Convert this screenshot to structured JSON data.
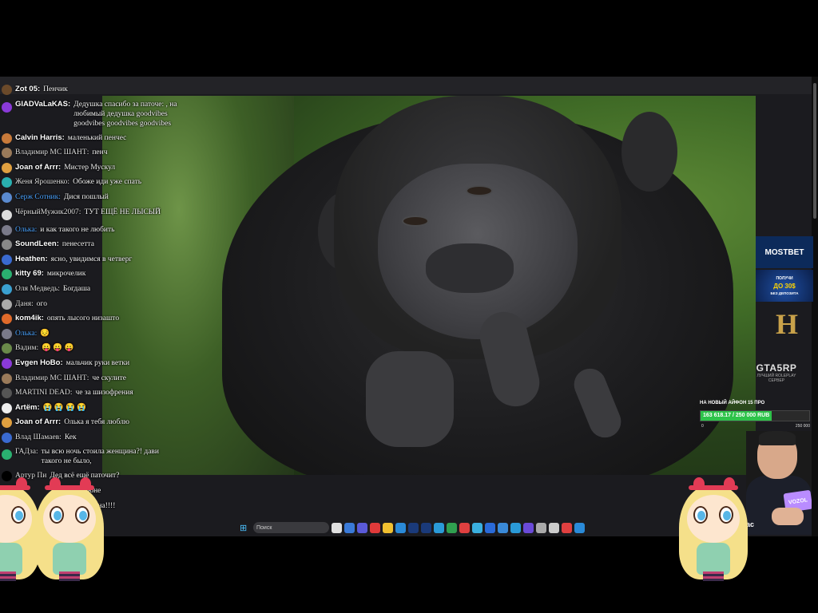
{
  "chat": {
    "messages": [
      {
        "user": "Zot 05:",
        "text": "Пенчик",
        "style": "bold",
        "avatar": "#6b4a2a"
      },
      {
        "user": "GlADVaLaKAS:",
        "text": "Дедушка спасибо за паточе: , на любимый дедушка  goodvibes  goodvibes  goodvibes  goodvibes",
        "style": "bold",
        "avatar": "#8a3ad8",
        "multi": true
      },
      {
        "user": "Calvin Harris:",
        "text": "маленький пенчес",
        "style": "bold",
        "avatar": "#c87a3a"
      },
      {
        "user": "Владимир MC ШАНТ:",
        "text": "пенч",
        "style": "plain",
        "avatar": "#9a7a5a"
      },
      {
        "user": "Joan of Arrr:",
        "text": "Мистер Мускул",
        "style": "bold",
        "avatar": "#e0a040"
      },
      {
        "user": "Женя Ярошенко:",
        "text": "Обоже иди уже спать",
        "style": "plain",
        "avatar": "#2ab0b0"
      },
      {
        "user": "Серж Сотник:",
        "text": "Дися пошлый",
        "style": "blue",
        "avatar": "#5a8ad0"
      },
      {
        "user": "ЧёрныйМужик2007:",
        "text": "ТУТ ЕЩЁ НЕ ЛЫСЫЙ",
        "style": "plain",
        "avatar": "#ddd",
        "multi": true
      },
      {
        "user": "Олька:",
        "text": "и как такого не любить",
        "style": "blue",
        "avatar": "#7a7a8a"
      },
      {
        "user": "SoundLeen:",
        "text": "пенесетта",
        "style": "bold",
        "avatar": "#888"
      },
      {
        "user": "Heathen:",
        "text": "ясно, увидимся в четверг",
        "style": "bold",
        "avatar": "#3a6ad0"
      },
      {
        "user": "kitty 69:",
        "text": "микрочелик",
        "style": "bold",
        "avatar": "#2ab070"
      },
      {
        "user": "Оля Медведь:",
        "text": "Богдаша",
        "style": "plain",
        "avatar": "#3aa0d0"
      },
      {
        "user": "Даня:",
        "text": "ого",
        "style": "plain",
        "avatar": "#aaa"
      },
      {
        "user": "kom4ik:",
        "text": "опять лысого низашто",
        "style": "bold",
        "avatar": "#e06a2a"
      },
      {
        "user": "Олька:",
        "text": "😔",
        "style": "blue",
        "avatar": "#7a7a8a"
      },
      {
        "user": "Вадим:",
        "text": "😛 😛 😛",
        "style": "plain",
        "avatar": "#6a8a4a"
      },
      {
        "user": "Evgen HoBo:",
        "text": "мальчик руки ветки",
        "style": "bold",
        "avatar": "#8a3ad8"
      },
      {
        "user": "Владимир MC ШАНТ:",
        "text": "че скулите",
        "style": "plain",
        "avatar": "#9a7a5a"
      },
      {
        "user": "MARTINI DEAD:",
        "text": "че за шизофрения",
        "style": "plain",
        "avatar": "#555"
      },
      {
        "user": "Artëm:",
        "text": "😭 😭 😭 😭",
        "style": "bold",
        "avatar": "#eee"
      },
      {
        "user": "Joan of Arrr:",
        "text": "Олька я тебя люблю",
        "style": "bold",
        "avatar": "#e0a040"
      },
      {
        "user": "Влад Шамаев:",
        "text": "Кек",
        "style": "plain",
        "avatar": "#3a6ad0"
      },
      {
        "user": "ГАДза:",
        "text": "ты всю ночь стоила женщина?! дави такого не было,",
        "style": "plain",
        "avatar": "#2ab070",
        "multi": true
      },
      {
        "user": "Артур Пи",
        "text": "Дед всё ещё паточит?",
        "style": "plain",
        "avatar": "#000"
      }
    ],
    "partial_lines": [
      "юне",
      "щина!!!!"
    ],
    "emote_name": "goodvibes"
  },
  "taskbar": {
    "start_glyph": "⊞",
    "search_placeholder": "Поиск",
    "icon_colors": [
      "#e0e0e0",
      "#3a7ad8",
      "#5a5ad8",
      "#e03a3a",
      "#f0c030",
      "#2a8ad8",
      "#1a3a7a",
      "#1a3a7a",
      "#2a9ad8",
      "#30a050",
      "#e04040",
      "#3ab0e0",
      "#2a6ad8",
      "#3a8ad8",
      "#2a9ad8",
      "#6a4ad8",
      "#aaa",
      "#ccc",
      "#e04040",
      "#2a8ad8"
    ]
  },
  "sidebar": {
    "mostbet": "MOSTBET",
    "promo_line1": "ПОЛУЧИ",
    "promo_line2": "ДО 30$",
    "promo_line3": "БЕЗ ДЕПОЗИТА",
    "h_logo": "H",
    "gta_title": "GTA5RP",
    "gta_sub1": "ЛУЧШИЙ ROLEPLAY",
    "gta_sub2": "СЕРВЕР"
  },
  "goal": {
    "title": "НА НОВЫЙ АЙФОН 15 ПРО",
    "progress_text": "163 618.17 / 250 000 RUB",
    "current": 163618.17,
    "target": 250000,
    "min_label": "0",
    "max_label": "250 000"
  },
  "cam": {
    "card_text": "VOZOL",
    "tag": "ас"
  },
  "colors": {
    "goal_fill": "#2ec34a",
    "mostbet_bg": "#0c2a5a"
  }
}
